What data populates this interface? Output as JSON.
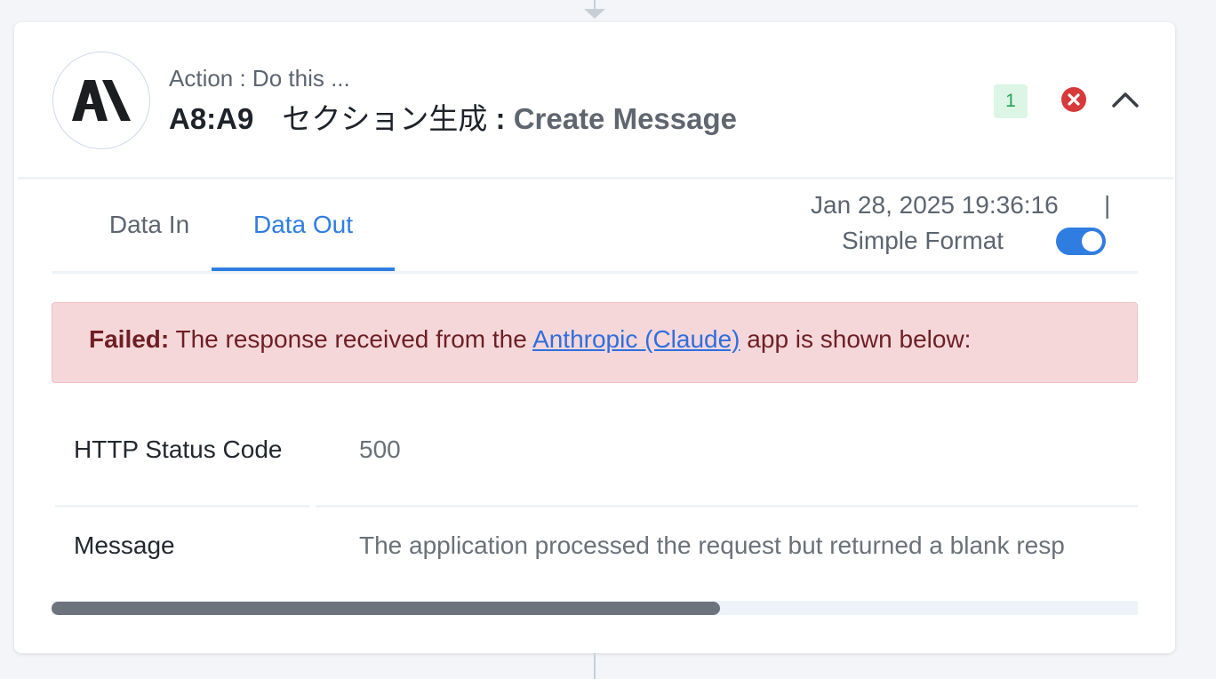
{
  "header": {
    "action_label": "Action : Do this ...",
    "step_code": "A8:A9",
    "step_name": "セクション生成",
    "separator": " : ",
    "operation": "Create Message",
    "app_logo_text": "AI",
    "count_badge": "1"
  },
  "icons": {
    "app_logo": "anthropic-logo-icon",
    "error": "error-circle-icon",
    "collapse": "chevron-up-icon"
  },
  "colors": {
    "accent": "#2f7de1",
    "error_red": "#d63a3a",
    "success_green": "#2aa35a",
    "alert_background": "#f5d7da"
  },
  "tabs": [
    {
      "label": "Data In",
      "active": false
    },
    {
      "label": "Data Out",
      "active": true
    }
  ],
  "meta": {
    "timestamp": "Jan 28, 2025 19:36:16",
    "pipe": "|",
    "format_label": "Simple Format",
    "simple_format_on": true
  },
  "alert": {
    "strong": "Failed:",
    "text_before": " The response received from the ",
    "link": "Anthropic (Claude)",
    "text_after": " app is shown below:"
  },
  "rows": [
    {
      "key": "HTTP Status Code",
      "value": "500"
    },
    {
      "key": "Message",
      "value": "The application processed the request but returned a blank resp"
    }
  ],
  "scroll": {
    "visible_fraction": 0.615
  }
}
